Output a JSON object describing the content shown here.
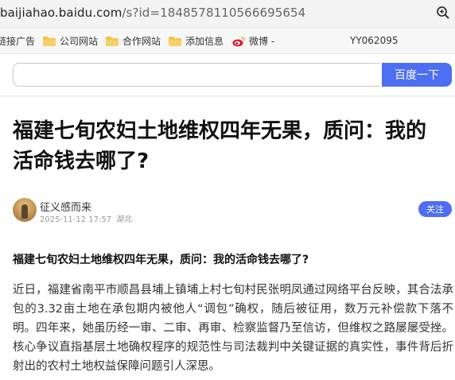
{
  "browser": {
    "url_host": "baijiahao.baidu.com",
    "url_rest": "/s?id=1848578110566695654"
  },
  "bookmarks": {
    "items": [
      {
        "label": "链接广告"
      },
      {
        "label": "公司网站"
      },
      {
        "label": "合作网站"
      },
      {
        "label": "添加信息"
      },
      {
        "label": "微博 -"
      }
    ],
    "extra": "YY062095"
  },
  "search": {
    "value": "",
    "button_label": "百度一下"
  },
  "article": {
    "title": "福建七旬农妇土地维权四年无果，质问：我的活命钱去哪了?",
    "author": "征义感而来",
    "date": "2025-11-12 17:57",
    "location": "湖北",
    "follow_label": "关注",
    "subtitle": "福建七旬农妇土地维权四年无果，质问：我的活命钱去哪了?",
    "paragraph": "近日，福建省南平市顺昌县埔上镇埔上村七旬村民张明凤通过网络平台反映，其合法承包的3.32亩土地在承包期内被他人“调包”确权，随后被征用，数万元补偿款下落不明。四年来，她虽历经一审、二审、再审、检察监督乃至信访，但维权之路屡屡受挫。核心争议直指基层土地确权程序的规范性与司法裁判中关键证据的真实性，事件背后折射出的农村土地权益保障问题引人深思。"
  },
  "colors": {
    "accent": "#4e6ef2",
    "folder": "#f2c14e"
  },
  "icons": [
    "zoom-icon",
    "folder-icon",
    "weibo-icon"
  ]
}
